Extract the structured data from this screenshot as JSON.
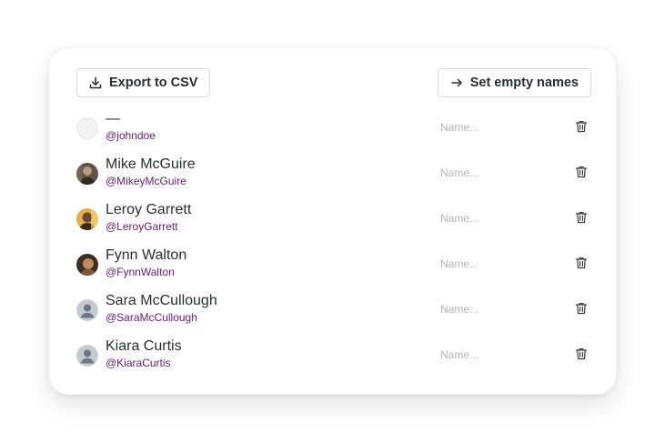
{
  "toolbar": {
    "export_label": "Export to CSV",
    "export_icon": "download-icon",
    "set_names_label": "Set empty names",
    "set_names_icon": "arrow-right-icon"
  },
  "users": [
    {
      "name": "—",
      "handle": "@johndoe",
      "name_placeholder": "Name...",
      "avatar": "blank"
    },
    {
      "name": "Mike McGuire",
      "handle": "@MikeyMcGuire",
      "name_placeholder": "Name...",
      "avatar": "photo"
    },
    {
      "name": "Leroy Garrett",
      "handle": "@LeroyGarrett",
      "name_placeholder": "Name...",
      "avatar": "photo"
    },
    {
      "name": "Fynn Walton",
      "handle": "@FynnWalton",
      "name_placeholder": "Name...",
      "avatar": "photo"
    },
    {
      "name": "Sara McCullough",
      "handle": "@SaraMcCullough",
      "name_placeholder": "Name...",
      "avatar": "default"
    },
    {
      "name": "Kiara Curtis",
      "handle": "@KiaraCurtis",
      "name_placeholder": "Name...",
      "avatar": "default"
    }
  ],
  "icons": {
    "delete": "trash-icon"
  },
  "colors": {
    "handle": "#6a1b7a",
    "text": "#2a2d33",
    "placeholder": "#b4b6bc",
    "border": "#dcdde1"
  }
}
